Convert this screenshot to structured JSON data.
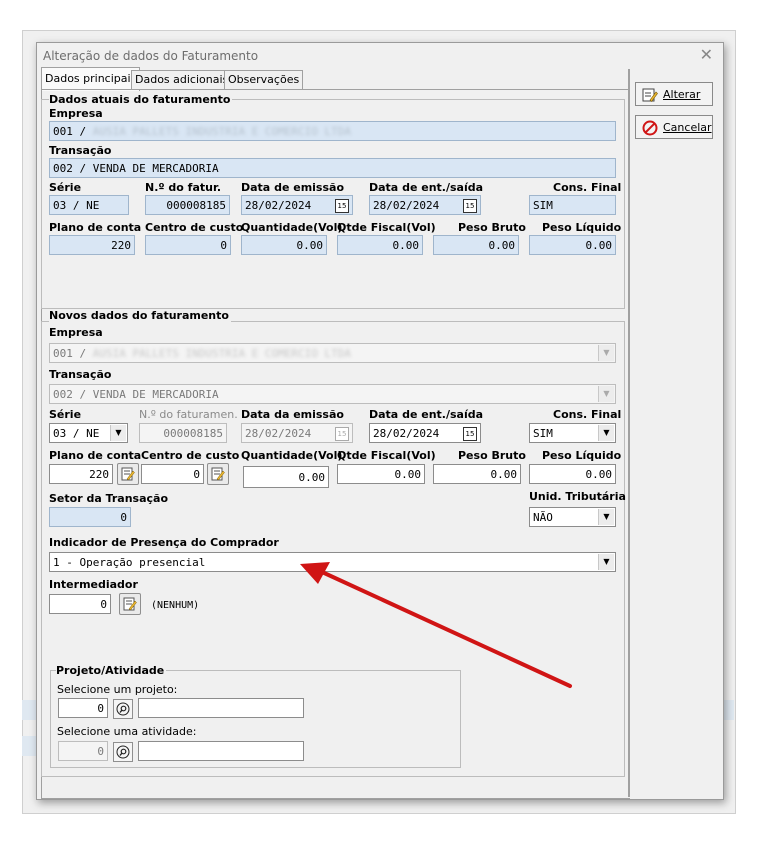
{
  "window": {
    "title": "Alteração de dados do Faturamento",
    "close_glyph": "✕"
  },
  "tabs": [
    {
      "label": "Dados principais",
      "active": true
    },
    {
      "label": "Dados adicionais",
      "active": false
    },
    {
      "label": "Observações",
      "active": false
    }
  ],
  "buttons": {
    "alterar": "Alterar",
    "cancelar": "Cancelar"
  },
  "atuais": {
    "legend": "Dados atuais do faturamento",
    "empresa_label": "Empresa",
    "empresa_prefix": "001 / ",
    "empresa_name": "AUSIA PALLETS INDUSTRIA E COMERCIO LTDA",
    "transacao_label": "Transação",
    "transacao_value": "002 / VENDA DE MERCADORIA",
    "serie_label": "Série",
    "serie_value": "03 / NE",
    "nfatur_label": "N.º do fatur.",
    "nfatur_value": "000008185",
    "emissao_label": "Data de emissão",
    "emissao_value": "28/02/2024",
    "entsaida_label": "Data de ent./saída",
    "entsaida_value": "28/02/2024",
    "consfinal_label": "Cons. Final",
    "consfinal_value": "SIM",
    "plano_label": "Plano de conta",
    "plano_value": "220",
    "centro_label": "Centro de custo",
    "centro_value": "0",
    "qtd_label": "Quantidade(Vol)",
    "qtd_value": "0.00",
    "qtdfiscal_label": "Qtde Fiscal(Vol)",
    "qtdfiscal_value": "0.00",
    "pesobruto_label": "Peso Bruto",
    "pesobruto_value": "0.00",
    "pesoliq_label": "Peso Líquido",
    "pesoliq_value": "0.00"
  },
  "novos": {
    "legend": "Novos dados do faturamento",
    "empresa_label": "Empresa",
    "empresa_prefix": "001 / ",
    "empresa_name": "AUSIA PALLETS INDUSTRIA E COMERCIO LTDA",
    "transacao_label": "Transação",
    "transacao_value": "002 / VENDA DE MERCADORIA",
    "serie_label": "Série",
    "serie_value": "03 / NE",
    "nfatur_label": "N.º do faturamen.",
    "nfatur_value": "000008185",
    "emissao_label": "Data da emissão",
    "emissao_value": "28/02/2024",
    "entsaida_label": "Data de ent./saída",
    "entsaida_value": "28/02/2024",
    "consfinal_label": "Cons. Final",
    "consfinal_value": "SIM",
    "plano_label": "Plano de conta",
    "plano_value": "220",
    "centro_label": "Centro de custo",
    "centro_value": "0",
    "qtd_label": "Quantidade(Vol)",
    "qtd_value": "0.00",
    "qtdfiscal_label": "Qtde Fiscal(Vol)",
    "qtdfiscal_value": "0.00",
    "pesobruto_label": "Peso Bruto",
    "pesobruto_value": "0.00",
    "pesoliq_label": "Peso Líquido",
    "pesoliq_value": "0.00",
    "setor_label": "Setor da Transação",
    "setor_value": "0",
    "unid_label": "Unid. Tributária",
    "unid_value": "NÃO",
    "indicador_label": "Indicador de Presença do Comprador",
    "indicador_value": "1 - Operação presencial",
    "intermediador_label": "Intermediador",
    "intermediador_value": "0",
    "intermediador_name": "(NENHUM)"
  },
  "projeto": {
    "legend": "Projeto/Atividade",
    "projeto_label": "Selecione um projeto:",
    "projeto_value": "0",
    "atividade_label": "Selecione uma atividade:",
    "atividade_value": "0"
  },
  "colors": {
    "field_blue": "#d9e6f4",
    "annotation_arrow": "#d01515"
  }
}
